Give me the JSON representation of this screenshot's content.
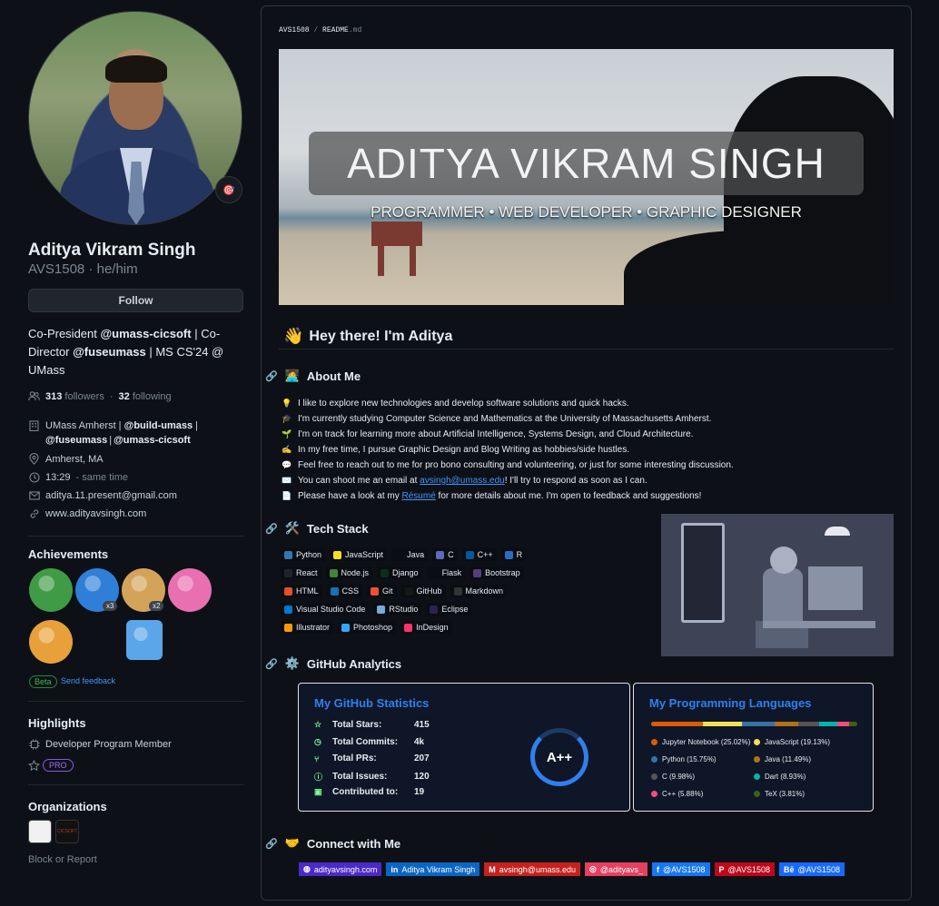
{
  "profile": {
    "name": "Aditya Vikram Singh",
    "username_line": "AVS1508 · he/him",
    "follow_label": "Follow",
    "status_emoji": "🎯",
    "bio": [
      {
        "t": "Co-President ",
        "b": false
      },
      {
        "t": "@umass-cicsoft",
        "b": true
      },
      {
        "t": " | Co-Director ",
        "b": false
      },
      {
        "t": "@fuseumass",
        "b": true
      },
      {
        "t": " | MS CS'24 @ UMass",
        "b": false
      }
    ],
    "followers_count": "313",
    "followers_label": "followers",
    "dot": "·",
    "following_count": "32",
    "following_label": "following",
    "org_line1_prefix": "UMass Amherst | ",
    "org_line1_bold": "@build-umass",
    "org_line1_suffix": " |",
    "org_line2_a": "@fuseumass",
    "org_line2_sep": " | ",
    "org_line2_b": "@umass-cicsoft",
    "location": "Amherst, MA",
    "time": "13:29",
    "time_note": "- same time",
    "email": "aditya.11.present@gmail.com",
    "website": "www.adityavsingh.com"
  },
  "achievements": {
    "title": "Achievements",
    "badges": [
      {
        "name": "pair-extraordinaire",
        "color": "#3f9b45",
        "count": ""
      },
      {
        "name": "pull-shark",
        "color": "#2f7fd8",
        "count": "x3"
      },
      {
        "name": "starstruck",
        "color": "#d4a35a",
        "count": "x2"
      },
      {
        "name": "yolo",
        "color": "#e86fb0",
        "count": ""
      },
      {
        "name": "quickdraw",
        "color": "#e8a03b",
        "count": ""
      },
      {
        "name": "arctic-code-vault",
        "color": "#5aa6e8",
        "count": ""
      }
    ],
    "beta_label": "Beta",
    "feedback_label": "Send feedback"
  },
  "highlights": {
    "title": "Highlights",
    "item": "Developer Program Member",
    "pro_label": "PRO"
  },
  "organizations": {
    "title": "Organizations",
    "org2_text": "CICSOFT"
  },
  "block_label": "Block or Report",
  "readme": {
    "path_owner": "AVS1508",
    "path_sep": "/",
    "path_file": "README",
    "path_ext": ".md",
    "banner_title": "ADITYA VIKRAM SINGH",
    "banner_subtitle": "PROGRAMMER • WEB DEVELOPER • GRAPHIC DESIGNER",
    "greeting_emoji": "👋",
    "greeting": "Hey there! I'm Aditya",
    "about_title": "About Me",
    "about_emoji": "🧑‍💻",
    "about_items": [
      {
        "e": "💡",
        "t": "I like to explore new technologies and develop software solutions and quick hacks.",
        "link": "",
        "after": ""
      },
      {
        "e": "🎓",
        "t": "I'm currently studying Computer Science and Mathematics at the University of Massachusetts Amherst.",
        "link": "",
        "after": ""
      },
      {
        "e": "🌱",
        "t": "I'm on track for learning more about Artificial Intelligence, Systems Design, and Cloud Architecture.",
        "link": "",
        "after": ""
      },
      {
        "e": "✍️",
        "t": "In my free time, I pursue Graphic Design and Blog Writing as hobbies/side hustles.",
        "link": "",
        "after": ""
      },
      {
        "e": "💬",
        "t": "Feel free to reach out to me for pro bono consulting and volunteering, or just for some interesting discussion.",
        "link": "",
        "after": ""
      },
      {
        "e": "✉️",
        "t": "You can shoot me an email at ",
        "link": "avsingh@umass.edu",
        "after": "! I'll try to respond as soon as I can."
      },
      {
        "e": "📄",
        "t": "Please have a look at my ",
        "link": "Résumé",
        "after": " for more details about me. I'm open to feedback and suggestions!"
      }
    ],
    "tech_title": "Tech Stack",
    "tech_emoji": "🛠️",
    "tech_rows": [
      [
        {
          "l": "Python",
          "c": "#3776ab"
        },
        {
          "l": "JavaScript",
          "c": "#f7df1e"
        },
        {
          "l": "Java",
          "c": "#0a0d12"
        },
        {
          "l": "C",
          "c": "#5c6bc0"
        },
        {
          "l": "C++",
          "c": "#00599c"
        },
        {
          "l": "R",
          "c": "#276dc3"
        }
      ],
      [
        {
          "l": "React",
          "c": "#20232a"
        },
        {
          "l": "Node.js",
          "c": "#43853d"
        },
        {
          "l": "Django",
          "c": "#092e20"
        },
        {
          "l": "Flask",
          "c": "#0a0d12"
        },
        {
          "l": "Bootstrap",
          "c": "#563d7c"
        }
      ],
      [
        {
          "l": "HTML",
          "c": "#e34f26"
        },
        {
          "l": "CSS",
          "c": "#1572b6"
        },
        {
          "l": "Git",
          "c": "#f05033"
        },
        {
          "l": "GitHub",
          "c": "#181717"
        },
        {
          "l": "Markdown",
          "c": "#333333"
        }
      ],
      [
        {
          "l": "Visual Studio Code",
          "c": "#007acc"
        },
        {
          "l": "RStudio",
          "c": "#75aadb"
        },
        {
          "l": "Eclipse",
          "c": "#2c2255"
        }
      ],
      [
        {
          "l": "Illustrator",
          "c": "#ff9a00"
        },
        {
          "l": "Photoshop",
          "c": "#31a8ff"
        },
        {
          "l": "InDesign",
          "c": "#ff3366"
        }
      ]
    ],
    "analytics_title": "GitHub Analytics",
    "analytics_emoji": "⚙️",
    "stats": {
      "title": "My GitHub Statistics",
      "rows": [
        {
          "icon": "☆",
          "label": "Total Stars:",
          "value": "415"
        },
        {
          "icon": "◷",
          "label": "Total Commits:",
          "value": "4k"
        },
        {
          "icon": "⑂",
          "label": "Total PRs:",
          "value": "207"
        },
        {
          "icon": "ⓘ",
          "label": "Total Issues:",
          "value": "120"
        },
        {
          "icon": "▣",
          "label": "Contributed to:",
          "value": "19"
        }
      ],
      "grade": "A++"
    },
    "langs": {
      "title": "My Programming Languages",
      "items": [
        {
          "name": "Jupyter Notebook (25.02%)",
          "pct": 25.02,
          "color": "#da5b0b"
        },
        {
          "name": "JavaScript (19.13%)",
          "pct": 19.13,
          "color": "#f1e05a"
        },
        {
          "name": "Python (15.75%)",
          "pct": 15.75,
          "color": "#3572a5"
        },
        {
          "name": "Java (11.49%)",
          "pct": 11.49,
          "color": "#b07219"
        },
        {
          "name": "C (9.98%)",
          "pct": 9.98,
          "color": "#555555"
        },
        {
          "name": "Dart (8.93%)",
          "pct": 8.93,
          "color": "#00b4ab"
        },
        {
          "name": "C++ (5.88%)",
          "pct": 5.88,
          "color": "#f34b7d"
        },
        {
          "name": "TeX (3.81%)",
          "pct": 3.81,
          "color": "#3d6117"
        }
      ]
    },
    "connect_title": "Connect with Me",
    "connect_emoji": "🤝",
    "connect": [
      {
        "l": "adityavsingh.com",
        "c": "#4b2ac7",
        "i": "◍"
      },
      {
        "l": "Aditya Vikram Singh",
        "c": "#0a66c2",
        "i": "in"
      },
      {
        "l": "avsingh@umass.edu",
        "c": "#c5221f",
        "i": "M"
      },
      {
        "l": "@adityavs_",
        "c": "#e4405f",
        "i": "◎"
      },
      {
        "l": "@AVS1508",
        "c": "#1877f2",
        "i": "f"
      },
      {
        "l": "@AVS1508",
        "c": "#bd081c",
        "i": "P"
      },
      {
        "l": "@AVS1508",
        "c": "#1769ff",
        "i": "Bē"
      }
    ]
  }
}
